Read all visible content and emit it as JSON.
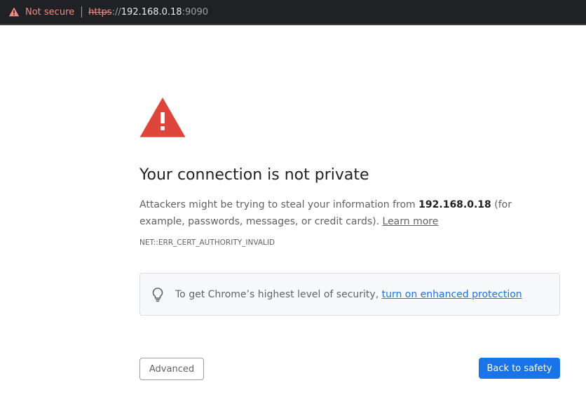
{
  "address_bar": {
    "security_label": "Not secure",
    "url_scheme": "https",
    "url_separator": "://",
    "url_host": "192.168.0.18",
    "url_port": ":9090"
  },
  "interstitial": {
    "title": "Your connection is not private",
    "body_prefix": "Attackers might be trying to steal your information from ",
    "body_host": "192.168.0.18",
    "body_suffix": " (for example, passwords, messages, or credit cards). ",
    "learn_more": "Learn more",
    "error_code": "NET::ERR_CERT_AUTHORITY_INVALID",
    "tip_text": "To get Chrome’s highest level of security, ",
    "tip_link": "turn on enhanced protection"
  },
  "buttons": {
    "advanced": "Advanced",
    "back_to_safety": "Back to safety"
  },
  "colors": {
    "warning_red": "#d93025",
    "link_blue": "#1a73e8",
    "dark_bar": "#202124"
  },
  "icons": {
    "address_warning": "warning-triangle-icon",
    "big_warning": "warning-triangle-icon",
    "tip": "lightbulb-icon"
  }
}
